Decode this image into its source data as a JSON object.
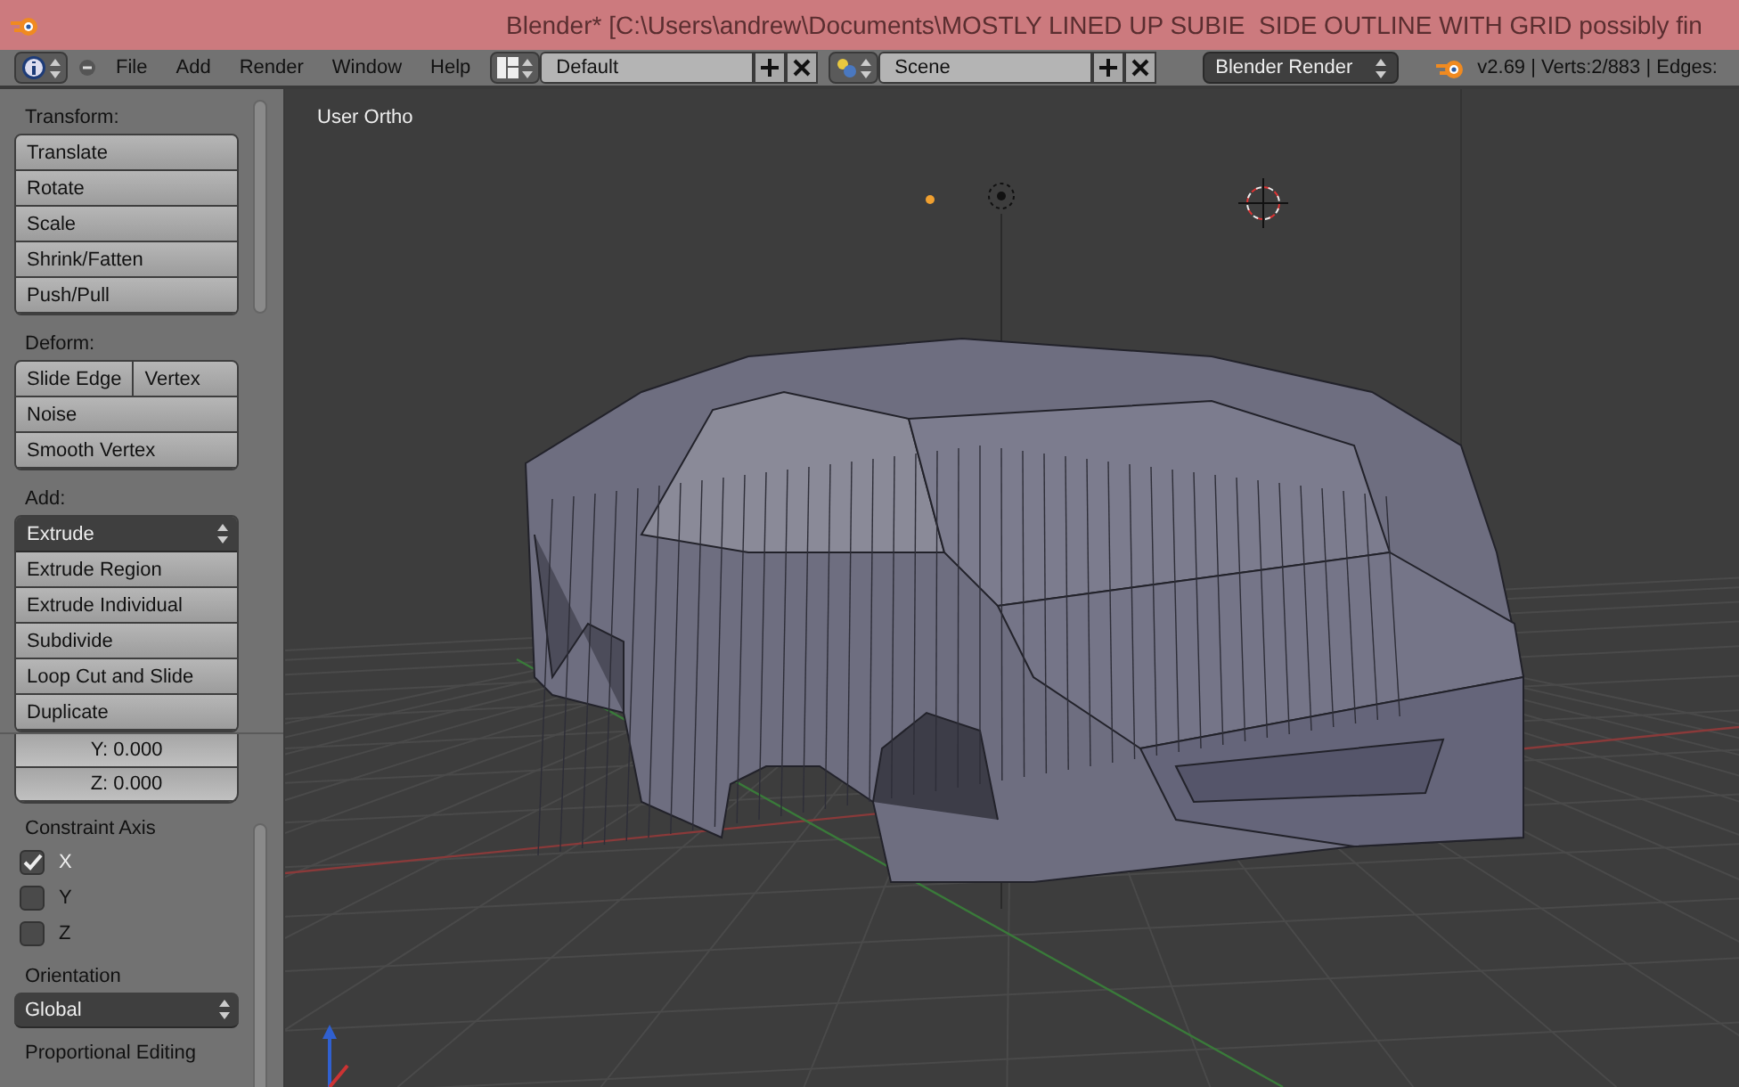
{
  "window": {
    "title": "Blender* [C:\\Users\\andrew\\Documents\\MOSTLY LINED UP SUBIE  SIDE OUTLINE WITH GRID possibly fin"
  },
  "header": {
    "menus": [
      "File",
      "Add",
      "Render",
      "Window",
      "Help"
    ],
    "layout": "Default",
    "scene": "Scene",
    "engine": "Blender Render",
    "stats": "v2.69 | Verts:2/883 | Edges:"
  },
  "tools": {
    "sections": [
      {
        "title": "Transform:",
        "rows": [
          [
            "Translate"
          ],
          [
            "Rotate"
          ],
          [
            "Scale"
          ],
          [
            "Shrink/Fatten"
          ],
          [
            "Push/Pull"
          ]
        ]
      },
      {
        "title": "Deform:",
        "rows": [
          [
            "Slide Edge",
            "Vertex"
          ],
          [
            "Noise"
          ],
          [
            "Smooth Vertex"
          ]
        ]
      },
      {
        "title": "Add:",
        "dropdown": "Extrude",
        "rows": [
          [
            "Extrude Region"
          ],
          [
            "Extrude Individual"
          ],
          [
            "Subdivide"
          ],
          [
            "Loop Cut and Slide"
          ],
          [
            "Duplicate"
          ]
        ]
      }
    ]
  },
  "operator": {
    "fields": [
      "Y: 0.000",
      "Z: 0.000"
    ],
    "constraint_label": "Constraint Axis",
    "axes": [
      {
        "label": "X",
        "checked": true
      },
      {
        "label": "Y",
        "checked": false
      },
      {
        "label": "Z",
        "checked": false
      }
    ],
    "orientation_label": "Orientation",
    "orientation": "Global",
    "proportional_label": "Proportional Editing"
  },
  "viewport": {
    "label": "User Ortho"
  }
}
